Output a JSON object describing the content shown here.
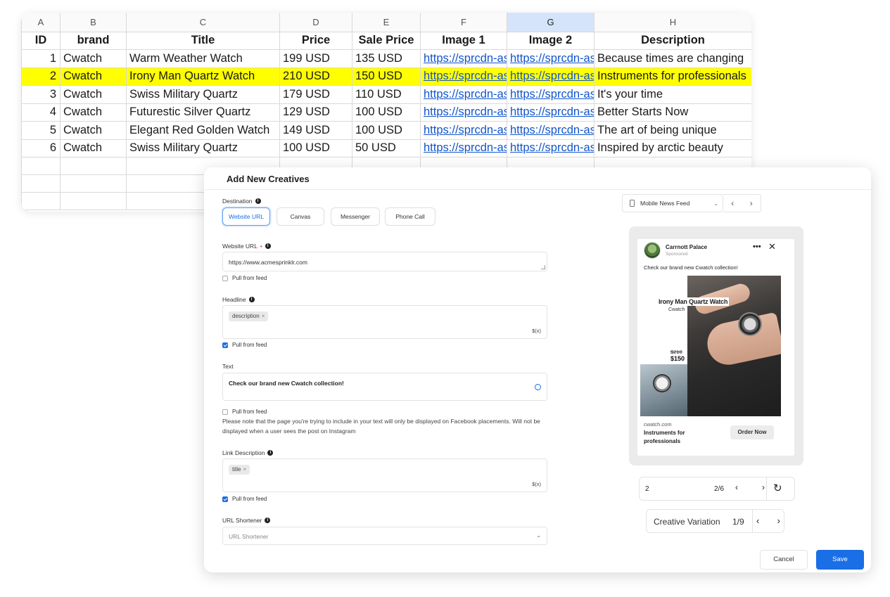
{
  "sheet": {
    "columns": [
      "A",
      "B",
      "C",
      "D",
      "E",
      "F",
      "G",
      "H"
    ],
    "selected_column": "G",
    "headers": [
      "ID",
      "brand",
      "Title",
      "Price",
      "Sale Price",
      "Image 1",
      "Image 2",
      "Description"
    ],
    "rows": [
      [
        "1",
        "Cwatch",
        "Warm Weather Watch",
        "199 USD",
        "135 USD",
        "https://sprcdn-as",
        "https://sprcdn-as",
        "Because times are changing"
      ],
      [
        "2",
        "Cwatch",
        "Irony Man Quartz Watch",
        "210 USD",
        "150 USD",
        "https://sprcdn-as",
        "https://sprcdn-as",
        "Instruments for professionals"
      ],
      [
        "3",
        "Cwatch",
        "Swiss Military Quartz",
        "179 USD",
        "110 USD",
        "https://sprcdn-as",
        "https://sprcdn-as",
        "It's your time"
      ],
      [
        "4",
        "Cwatch",
        "Futurestic Silver Quartz",
        "129 USD",
        "100 USD",
        "https://sprcdn-as",
        "https://sprcdn-as",
        "Better Starts Now"
      ],
      [
        "5",
        "Cwatch",
        "Elegant Red Golden Watch",
        "149 USD",
        "100 USD",
        "https://sprcdn-as",
        "https://sprcdn-as",
        "The art of being unique"
      ],
      [
        "6",
        "Cwatch",
        "Swiss Military Quartz",
        "100 USD",
        "50 USD",
        "https://sprcdn-as",
        "https://sprcdn-as",
        "Inspired by arctic beauty"
      ]
    ],
    "highlighted_row": 2,
    "highlight_color": "#ffff00",
    "link_color": "#1155cc"
  },
  "modal": {
    "title": "Add New Creatives",
    "destination": {
      "label": "Destination",
      "options": [
        "Website URL",
        "Canvas",
        "Messenger",
        "Phone Call"
      ],
      "selected": "Website URL"
    },
    "website_url": {
      "label": "Website URL",
      "value": "https://www.acmesprinklr.com",
      "pull_label": "Pull from feed",
      "pull_checked": false
    },
    "headline": {
      "label": "Headline",
      "chip": "description",
      "suffix": "$(x)",
      "pull_label": "Pull from feed",
      "pull_checked": true
    },
    "text": {
      "label": "Text",
      "value": "Check our brand new Cwatch collection!",
      "pull_label": "Pull from feed",
      "pull_checked": false,
      "note": "Please note that the page you're trying to include in your text will only be displayed on Facebook placements. Will not be displayed when a user sees the post on Instagram"
    },
    "link_description": {
      "label": "Link Description",
      "chip": "title",
      "suffix": "$(x)",
      "pull_label": "Pull from feed",
      "pull_checked": true
    },
    "url_shortener": {
      "label": "URL Shortener",
      "placeholder": "URL Shortener"
    },
    "placement": {
      "value": "Mobile News Feed"
    },
    "preview": {
      "page_name": "Carrnott Palace",
      "sponsored": "Sponsored",
      "post_text": "Check our brand new Cwatch collection!",
      "product": "Irony Man Quartz Watch",
      "brand": "Cwatch",
      "old_price": "$210",
      "new_price": "$150",
      "domain": "cwatch.com",
      "headline": "Instruments for professionals",
      "cta": "Order Now"
    },
    "row_pager": {
      "value": "2",
      "count": "2/6"
    },
    "variation_pager": {
      "label": "Creative Variation",
      "count": "1/9"
    },
    "buttons": {
      "cancel": "Cancel",
      "save": "Save"
    },
    "accent_color": "#1a6ee6"
  }
}
